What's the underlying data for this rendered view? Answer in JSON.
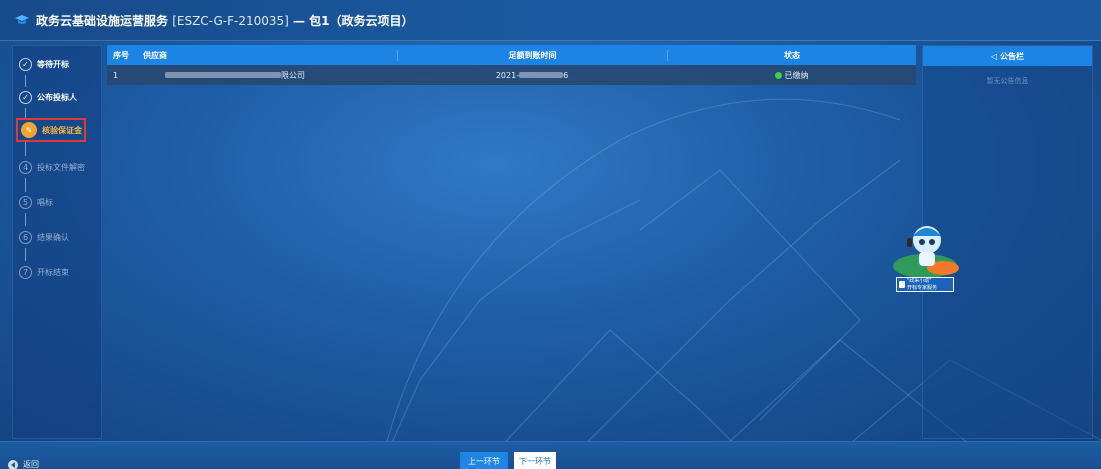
{
  "header": {
    "title": "政务云基础设施运营服务",
    "code": "[ESZC-G-F-210035]",
    "suffix": "— 包1（政务云项目）"
  },
  "steps": [
    {
      "num": "✓",
      "label": "等待开标",
      "state": "done"
    },
    {
      "num": "✓",
      "label": "公布投标人",
      "state": "done"
    },
    {
      "num": "✎",
      "label": "核验保证金",
      "state": "active"
    },
    {
      "num": "4",
      "label": "投标文件解密",
      "state": "pending"
    },
    {
      "num": "5",
      "label": "唱标",
      "state": "pending"
    },
    {
      "num": "6",
      "label": "结果确认",
      "state": "pending"
    },
    {
      "num": "7",
      "label": "开标结束",
      "state": "pending"
    }
  ],
  "table": {
    "headers": {
      "index": "序号",
      "supplier": "供应商",
      "time": "足额到账时间",
      "status": "状态"
    },
    "rows": [
      {
        "index": "1",
        "supplier_suffix": "限公司",
        "time_prefix": "2021-",
        "time_suffix": "6",
        "status": "已缴纳"
      }
    ]
  },
  "notice": {
    "title": "◁ 公告栏",
    "empty": "暂无公告信息"
  },
  "mascot": {
    "line1": "\"政采小助\"",
    "line2": "开标专家服务"
  },
  "footer": {
    "back": "返回",
    "prev": "上一环节",
    "next": "下一环节"
  },
  "colors": {
    "accent": "#1c84e4",
    "active_step": "#f0a533",
    "highlight_border": "#e23a33",
    "status_ok": "#3ccf4e"
  }
}
